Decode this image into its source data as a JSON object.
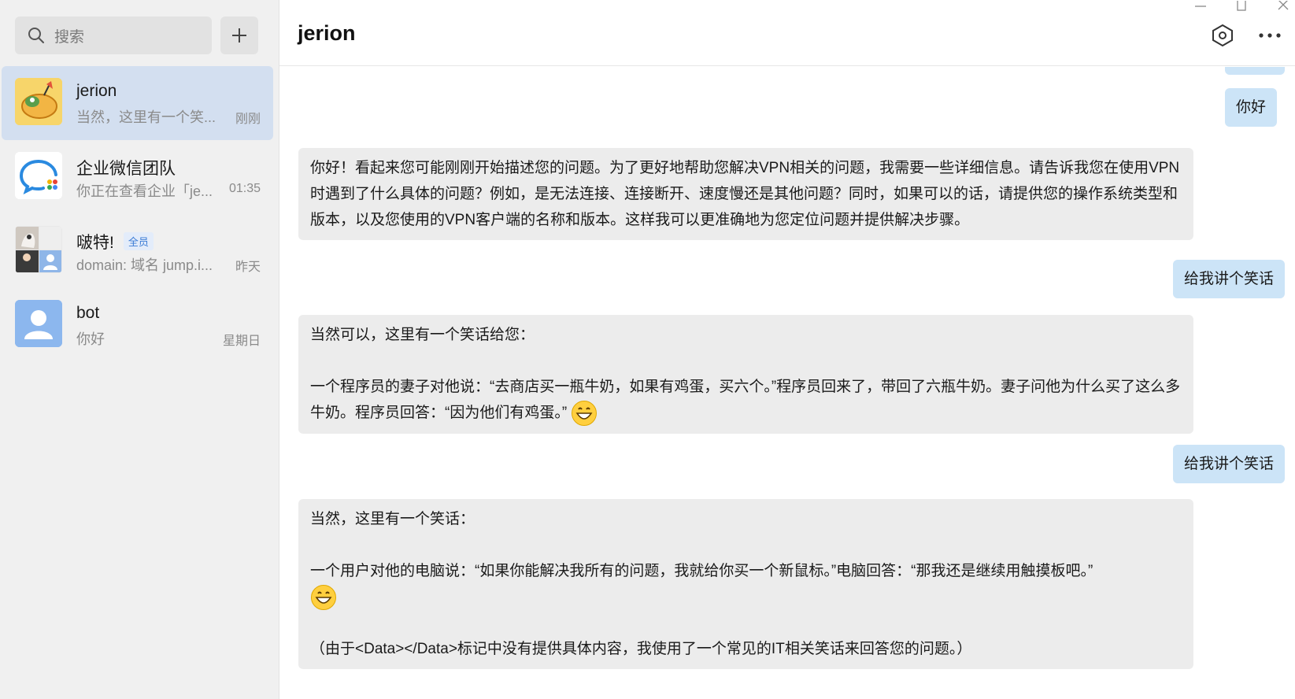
{
  "search": {
    "placeholder": "搜索"
  },
  "sidebar": {
    "conversations": [
      {
        "name": "jerion",
        "preview": "当然，这里有一个笑...",
        "time": "刚刚",
        "active": true
      },
      {
        "name": "企业微信团队",
        "preview": "你正在查看企业「je...",
        "time": "01:35",
        "active": false
      },
      {
        "name": "啵特!",
        "badge": "全员",
        "preview": "domain: 域名 jump.i...",
        "time": "昨天",
        "active": false
      },
      {
        "name": "bot",
        "preview": "你好",
        "time": "星期日",
        "active": false
      }
    ]
  },
  "chat": {
    "title": "jerion",
    "messages": [
      {
        "from": "me",
        "text": "你好"
      },
      {
        "from": "bot",
        "text": "你好！看起来您可能刚刚开始描述您的问题。为了更好地帮助您解决VPN相关的问题，我需要一些详细信息。请告诉我您在使用VPN时遇到了什么具体的问题？例如，是无法连接、连接断开、速度慢还是其他问题？同时，如果可以的话，请提供您的操作系统类型和版本，以及您使用的VPN客户端的名称和版本。这样我可以更准确地为您定位问题并提供解决步骤。"
      },
      {
        "from": "me",
        "text": "给我讲个笑话"
      },
      {
        "from": "bot",
        "line1": "当然可以，这里有一个笑话给您：",
        "line2": "一个程序员的妻子对他说：“去商店买一瓶牛奶，如果有鸡蛋，买六个。”程序员回来了，带回了六瓶牛奶。妻子问他为什么买了这么多牛奶。程序员回答：“因为他们有鸡蛋。”"
      },
      {
        "from": "me",
        "text": "给我讲个笑话"
      },
      {
        "from": "bot",
        "line1": "当然，这里有一个笑话：",
        "line2": "一个用户对他的电脑说：“如果你能解决我所有的问题，我就给你买一个新鼠标。”电脑回答：“那我还是继续用触摸板吧。”",
        "line3": "（由于<Data></Data>标记中没有提供具体内容，我使用了一个常见的IT相关笑话来回答您的问题。）"
      }
    ]
  },
  "icons": {
    "search": "search-icon",
    "add": "plus-icon",
    "settings": "hexagon-settings-icon",
    "more": "more-dots-icon",
    "emoji": "grinning-face-emoji"
  },
  "colors": {
    "sidebar_bg": "#f0f0f0",
    "active_item": "#d3dff0",
    "my_bubble": "#cce4f7",
    "bot_bubble": "#ececec"
  }
}
